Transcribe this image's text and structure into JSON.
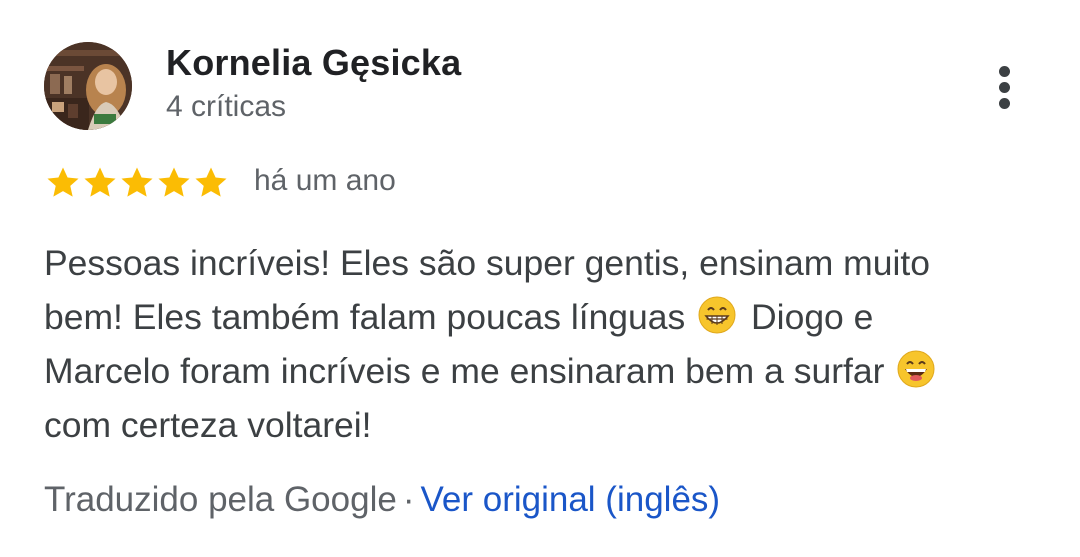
{
  "reviewer": {
    "name": "Kornelia Gęsicka",
    "review_count": "4 críticas"
  },
  "rating": {
    "stars": 5,
    "max": 5,
    "color": "#fbbc04"
  },
  "date": "há um ano",
  "review": {
    "line1": "Pessoas incríveis! Eles são super gentis, ensinam muito",
    "line2a": "bem! Eles também falam poucas línguas",
    "emoji1": "grinning-face-with-smiling-eyes-emoji",
    "line2b": "Diogo e",
    "line3a": "Marcelo foram incríveis e me ensinaram bem a surfar",
    "emoji2": "grinning-face-with-big-eyes-emoji",
    "line4": "com certeza voltarei!"
  },
  "translation": {
    "label": "Traduzido pela Google",
    "separator": "·",
    "link": "Ver original (inglês)",
    "link_color": "#1a56c8"
  },
  "icons": {
    "more": "more-vert-icon",
    "star": "star-icon"
  }
}
